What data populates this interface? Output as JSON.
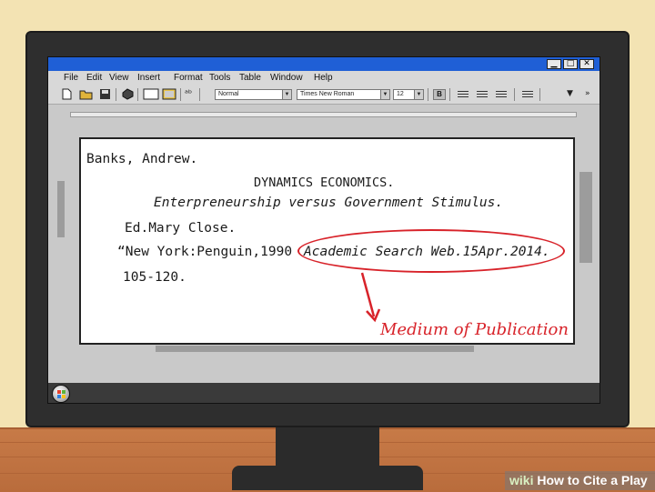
{
  "window": {
    "controls": [
      "▁",
      "□",
      "✕"
    ]
  },
  "menu": [
    "File",
    "Edit",
    "View",
    "Insert",
    "Format",
    "Tools",
    "Table",
    "Window",
    "Help"
  ],
  "toolbar": {
    "style_value": "Normal",
    "font_value": "Times New Roman",
    "size_value": "12",
    "bold_label": "B"
  },
  "document": {
    "line1": "Banks, Andrew.",
    "line2": "DYNAMICS ECONOMICS.",
    "line3": "Enterpreneurship versus Government Stimulus.",
    "line4": "Ed.Mary Close.",
    "line5_a": "“New York:Penguin,1990",
    "line5_b": "Academic Search Web.15Apr.2014.",
    "line6": "105-120."
  },
  "annotation": {
    "label": "Medium of Publication",
    "color": "#d8232a"
  },
  "watermark": {
    "prefix": "wiki",
    "text": "How to Cite a Play"
  }
}
